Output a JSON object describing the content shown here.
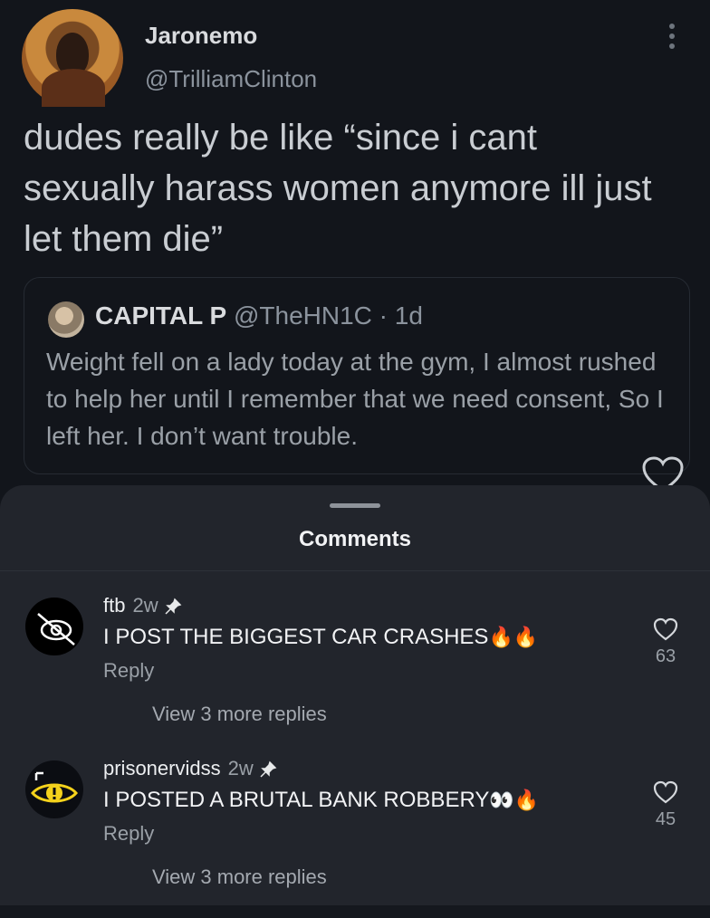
{
  "tweet": {
    "author_name": "Jaronemo",
    "author_handle": "@TrilliamClinton",
    "text": "dudes really be like “since i cant sexually harass women anymore ill just let them die”",
    "quote": {
      "name": "CAPITAL P",
      "handle_time": "@TheHN1C · 1d",
      "text": "Weight fell on a lady today at the gym, I almost rushed to help her until I remember that we need consent, So I left her. I don’t want trouble."
    }
  },
  "sheet": {
    "title": "Comments",
    "comments": [
      {
        "user": "ftb",
        "time": "2w",
        "text": "I POST THE BIGGEST CAR CRASHES",
        "emoji": "🔥🔥",
        "reply_label": "Reply",
        "likes": "63",
        "view_replies": "View 3 more replies"
      },
      {
        "user": "prisonervidss",
        "time": "2w",
        "text": "I POSTED A BRUTAL BANK ROBBERY",
        "emoji": "👀🔥",
        "reply_label": "Reply",
        "likes": "45",
        "view_replies": "View 3 more replies"
      }
    ]
  },
  "icons": [
    "more-vertical-icon",
    "heart-icon",
    "pin-icon",
    "fire-emoji",
    "eyes-emoji"
  ],
  "colors": {
    "background": "#12151b",
    "sheet": "#22252c",
    "text": "#f2f3f5",
    "muted": "#9aa0a7"
  }
}
